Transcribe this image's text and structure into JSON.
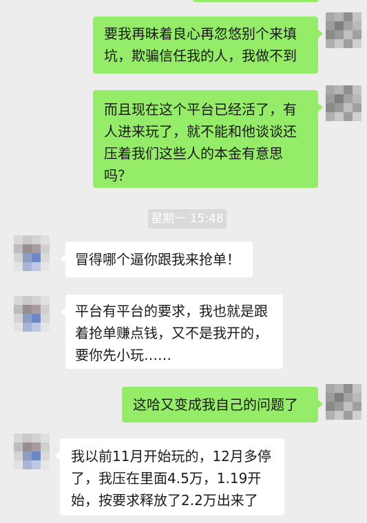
{
  "chat": {
    "time_divider": "星期一 15:48",
    "messages": [
      {
        "side": "out",
        "text": "要我再昧着良心再忽悠别个来填坑，欺骗信任我的人，我做不到"
      },
      {
        "side": "out",
        "text": "而且现在这个平台已经活了，有人进来玩了，就不能和他谈谈还压着我们这些人的本金有意思吗？"
      },
      {
        "side": "in",
        "text": "冒得哪个逼你跟我来抢单！"
      },
      {
        "side": "in",
        "text": "平台有平台的要求，我也就是跟着抢单赚点钱，又不是我开的，要你先小玩……"
      },
      {
        "side": "out",
        "text": "这哈又变成我自己的问题了"
      },
      {
        "side": "in",
        "text": "我以前11月开始玩的，12月多停了，我压在里面4.5万，1.19开始，按要求释放了2.2万出来了"
      }
    ]
  },
  "colors": {
    "background": "#ededed",
    "outgoing_bubble": "#95ec69",
    "incoming_bubble": "#ffffff",
    "time_label_bg": "#dadada"
  }
}
